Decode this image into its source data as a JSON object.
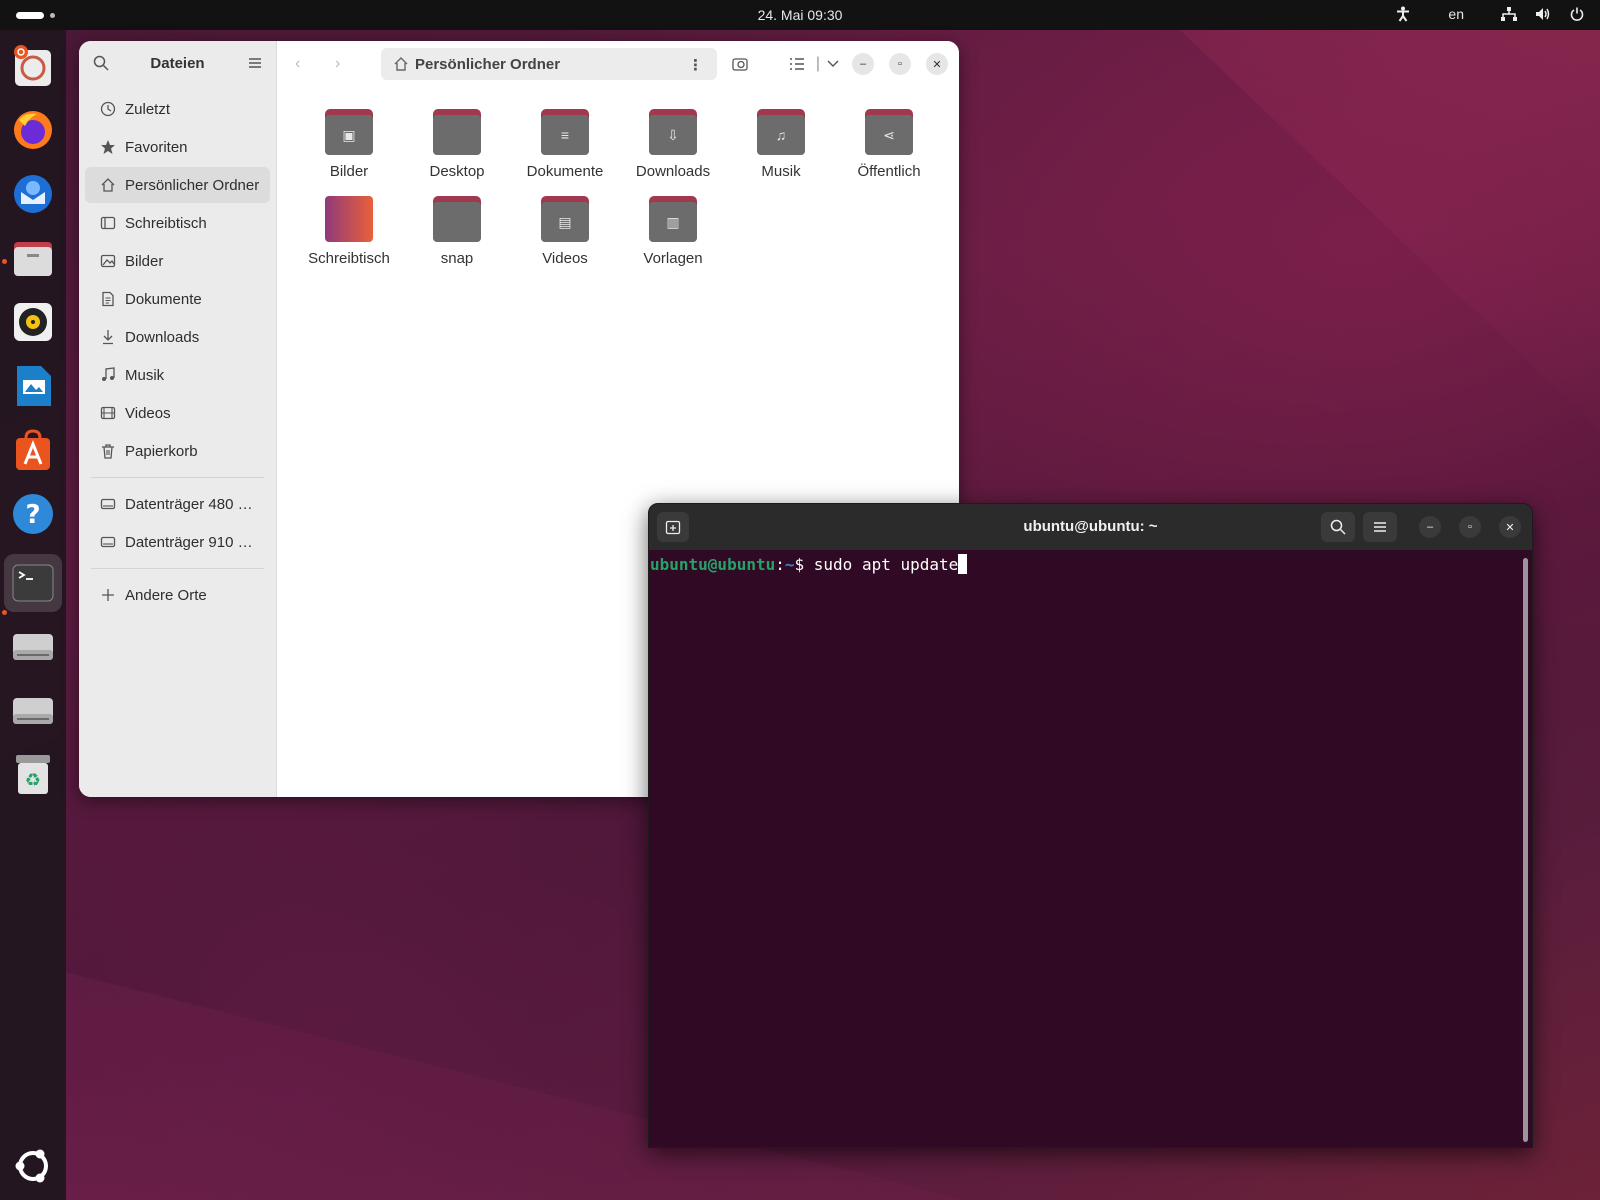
{
  "topbar": {
    "clock": "24. Mai  09:30",
    "language": "en"
  },
  "dock": {
    "items": [
      {
        "name": "installer"
      },
      {
        "name": "firefox"
      },
      {
        "name": "thunderbird"
      },
      {
        "name": "files"
      },
      {
        "name": "rhythmbox"
      },
      {
        "name": "libreoffice-writer"
      },
      {
        "name": "app-center"
      },
      {
        "name": "help"
      },
      {
        "name": "terminal"
      },
      {
        "name": "drive-1"
      },
      {
        "name": "drive-2"
      },
      {
        "name": "trash"
      }
    ]
  },
  "files": {
    "title": "Dateien",
    "path": "Persönlicher Ordner",
    "sidebar": {
      "items": [
        {
          "label": "Zuletzt",
          "icon": "clock-icon"
        },
        {
          "label": "Favoriten",
          "icon": "star-icon"
        },
        {
          "label": "Persönlicher Ordner",
          "icon": "home-icon"
        },
        {
          "label": "Schreibtisch",
          "icon": "desktop-icon"
        },
        {
          "label": "Bilder",
          "icon": "image-icon"
        },
        {
          "label": "Dokumente",
          "icon": "document-icon"
        },
        {
          "label": "Downloads",
          "icon": "download-icon"
        },
        {
          "label": "Musik",
          "icon": "music-icon"
        },
        {
          "label": "Videos",
          "icon": "video-icon"
        },
        {
          "label": "Papierkorb",
          "icon": "trash-icon"
        }
      ],
      "drives": [
        {
          "label": "Datenträger 480 …",
          "icon": "drive-icon"
        },
        {
          "label": "Datenträger 910 …",
          "icon": "drive-icon"
        }
      ],
      "other": "Andere Orte"
    },
    "folders": [
      {
        "label": "Bilder",
        "glyph": "▣"
      },
      {
        "label": "Desktop",
        "glyph": ""
      },
      {
        "label": "Dokumente",
        "glyph": "≡"
      },
      {
        "label": "Downloads",
        "glyph": "⇩"
      },
      {
        "label": "Musik",
        "glyph": "♫"
      },
      {
        "label": "Öffentlich",
        "glyph": "⋖"
      },
      {
        "label": "Schreibtisch",
        "glyph": ""
      },
      {
        "label": "snap",
        "glyph": ""
      },
      {
        "label": "Videos",
        "glyph": "▤"
      },
      {
        "label": "Vorlagen",
        "glyph": "▥"
      }
    ]
  },
  "terminal": {
    "title": "ubuntu@ubuntu: ~",
    "prompt_user": "ubuntu@ubuntu",
    "prompt_sep": ":",
    "prompt_path": "~",
    "prompt_sign": "$ ",
    "command": "sudo apt update"
  },
  "colors": {
    "accent": "#e9541f",
    "terminal_bg": "#300a24",
    "prompt_user": "#26a269",
    "prompt_path": "#3a7fd9"
  }
}
